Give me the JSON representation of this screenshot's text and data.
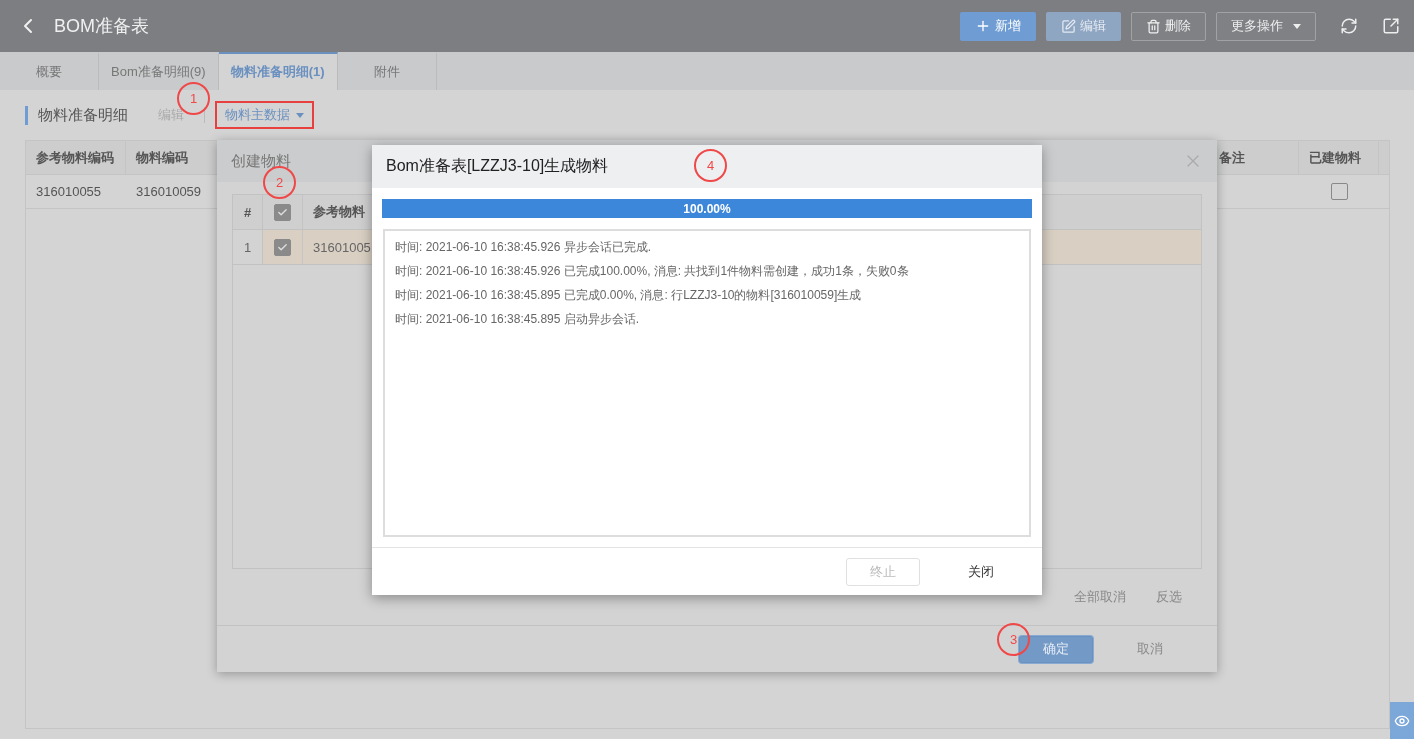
{
  "header": {
    "title": "BOM准备表",
    "actions": [
      {
        "label": "新增",
        "kind": "add",
        "disabled": false
      },
      {
        "label": "编辑",
        "kind": "edit",
        "disabled": true
      },
      {
        "label": "删除",
        "kind": "delete",
        "disabled": false
      },
      {
        "label": "更多操作",
        "kind": "menu",
        "disabled": false
      }
    ]
  },
  "tabs": [
    {
      "label": "概要",
      "selected": false
    },
    {
      "label": "Bom准备明细(9)",
      "selected": false
    },
    {
      "label": "物料准备明细(1)",
      "selected": true
    },
    {
      "label": "附件",
      "selected": false
    }
  ],
  "section": {
    "title": "物料准备明细",
    "actions": [
      {
        "label": "编辑",
        "kind": "plain",
        "disabled": true,
        "highlighted": false
      },
      {
        "label": "物料主数据",
        "kind": "dropdown",
        "disabled": false,
        "highlighted": true
      }
    ]
  },
  "table": {
    "columns": [
      "参考物料编码",
      "物料编码",
      "备注",
      "已建物料"
    ],
    "rows": [
      {
        "cells": [
          "316010055",
          "316010059"
        ],
        "built": false
      }
    ]
  },
  "create_dialog": {
    "title": "创建物料",
    "table": {
      "columns": [
        "#",
        "",
        "参考物料"
      ],
      "header_checked": true,
      "rows": [
        {
          "checked": true,
          "selected": true,
          "cells": [
            "1",
            "",
            "31601005"
          ]
        }
      ]
    },
    "selection_actions": [
      "全部取消",
      "反选"
    ],
    "buttons": [
      {
        "label": "确定",
        "kind": "primary"
      },
      {
        "label": "取消",
        "kind": "plain"
      }
    ]
  },
  "progress_dialog": {
    "title": "Bom准备表[LZZJ3-10]生成物料",
    "progress": {
      "level": 1,
      "reading": "100.00%"
    },
    "log": [
      "时间: 2021-06-10 16:38:45.926 异步会话已完成.",
      "时间: 2021-06-10 16:38:45.926 已完成100.00%, 消息: 共找到1件物料需创建，成功1条，失败0条",
      "时间: 2021-06-10 16:38:45.895 已完成0.00%, 消息: 行LZZJ3-10的物料[316010059]生成",
      "时间: 2021-06-10 16:38:45.895 启动异步会话."
    ],
    "buttons": [
      {
        "label": "终止",
        "kind": "outline",
        "disabled": true
      },
      {
        "label": "关闭",
        "kind": "plain",
        "disabled": false
      }
    ]
  },
  "annotations": [
    {
      "label": "1"
    },
    {
      "label": "2"
    },
    {
      "label": "3"
    },
    {
      "label": "4"
    }
  ]
}
